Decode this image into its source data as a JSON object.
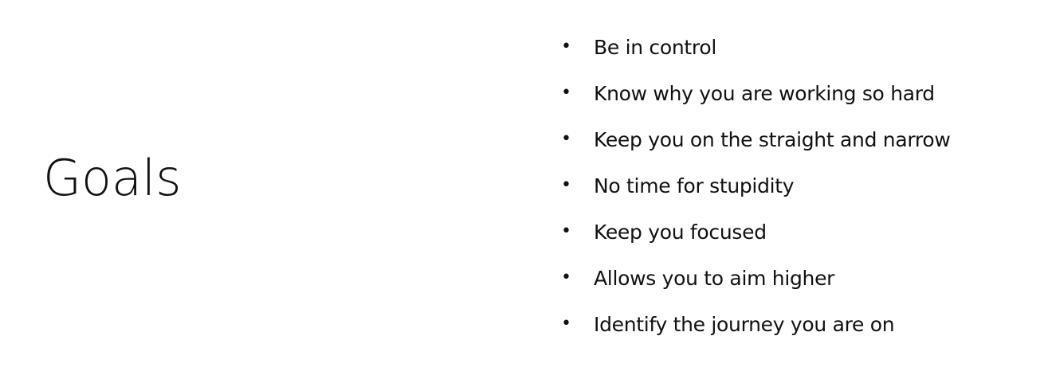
{
  "slide": {
    "title": "Goals",
    "bullet_glyph": "•",
    "bullets": [
      "Be in control",
      "Know why you are working so hard",
      "Keep you on the straight and narrow",
      "No time for stupidity",
      "Keep you focused",
      "Allows you to aim higher",
      "Identify the journey you are on"
    ]
  },
  "colors": {
    "background": "#ffffff",
    "text": "#111111"
  }
}
